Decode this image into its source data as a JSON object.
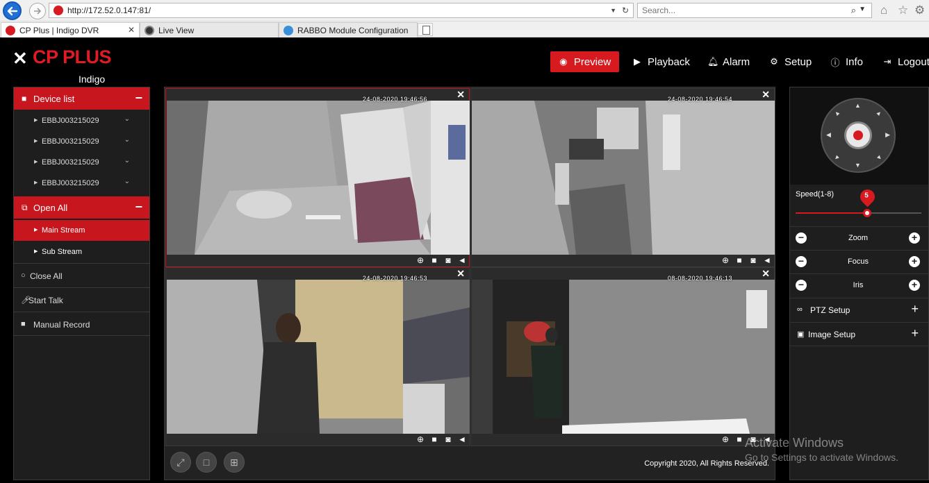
{
  "browser": {
    "url": "http://172.52.0.147:81/",
    "search_placeholder": "Search...",
    "tabs": [
      {
        "label": "CP Plus | Indigo DVR"
      },
      {
        "label": "Live View"
      },
      {
        "label": "RABBO Module Configuration"
      }
    ]
  },
  "app": {
    "brand": "CP PLUS",
    "brand_sub": "Indigo",
    "nav": {
      "preview": "Preview",
      "playback": "Playback",
      "alarm": "Alarm",
      "setup": "Setup",
      "info": "Info",
      "logout": "Logout"
    }
  },
  "left_panel": {
    "device_list_title": "Device list",
    "devices": [
      "EBBJ003215029",
      "EBBJ003215029",
      "EBBJ003215029",
      "EBBJ003215029"
    ],
    "open_all_title": "Open All",
    "streams": [
      "Main Stream",
      "Sub Stream"
    ],
    "close_all": "Close All",
    "start_talk": "Start Talk",
    "manual_record": "Manual Record"
  },
  "video": {
    "cells": [
      {
        "timestamp": "24-08-2020 19:46:56"
      },
      {
        "timestamp": "24-08-2020 19:46:54"
      },
      {
        "timestamp": "24-08-2020 19:46:53"
      },
      {
        "timestamp": "08-08-2020 19:46:13"
      }
    ],
    "copyright": "Copyright 2020, All Rights Reserved."
  },
  "ptz": {
    "speed_label": "Speed(1-8)",
    "speed_value": "5",
    "speed_max": 8,
    "zoom": "Zoom",
    "focus": "Focus",
    "iris": "Iris",
    "ptz_setup": "PTZ Setup",
    "image_setup": "Image Setup"
  },
  "watermark": {
    "line1": "Activate Windows",
    "line2": "Go to Settings to activate Windows."
  },
  "colors": {
    "accent": "#d71920",
    "panel_bg": "#1e1e1e"
  }
}
